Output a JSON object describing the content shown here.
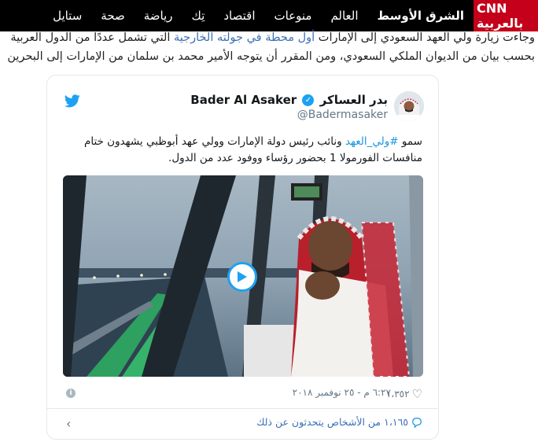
{
  "nav": {
    "logo": "CNN بالعربية",
    "items": [
      "الشرق الأوسط",
      "العالم",
      "منوعات",
      "اقتصاد",
      "تِك",
      "رياضة",
      "صحة",
      "ستايل"
    ]
  },
  "article": {
    "line1_start": "وجاءت زيارة ولي العهد السعودي إلى الإمارات ",
    "line1_link": "أول محطة في جولته الخارجية",
    "line1_end": " التي تشمل عددًا من الدول العربية",
    "line2": "بحسب بيان من الديوان الملكي السعودي، ومن المقرر أن يتوجه الأمير محمد بن سلمان من الإمارات إلى البحرين"
  },
  "tweet": {
    "author_name_ar": "بدر العساكر",
    "author_name_en": "Bader Al Asaker",
    "handle": "@Badermasaker",
    "text_before": "سمو ",
    "hashtag": "#ولي_العهد",
    "text_after": " ونائب رئيس دولة الإمارات وولي عهد أبوظبي يشهدون ختام منافسات الفورمولا 1 بحضور رؤساء ووفود عدد من الدول.",
    "likes": "١،٣٥٢",
    "timestamp": "٦:٢٧ م - ٢٥ نوفمبر ٢٠١٨",
    "conversation": "١،١٦٥ من الأشخاص يتحدثون عن ذلك",
    "info_glyph": "i",
    "chevron_glyph": "‹",
    "heart_glyph": "♡",
    "check_glyph": "✓",
    "colors": {
      "accent": "#1da1f2",
      "brand": "#c4001a"
    }
  }
}
